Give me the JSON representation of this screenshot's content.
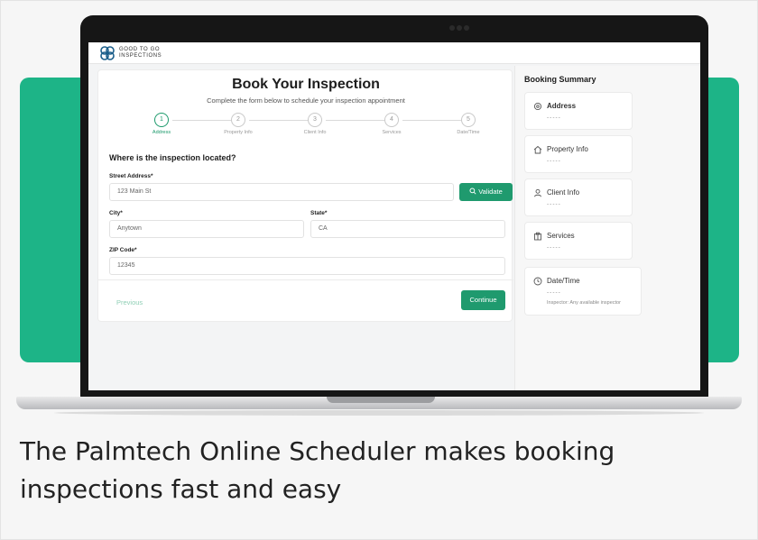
{
  "logo": {
    "line1": "GOOD TO GO",
    "line2": "INSPECTIONS"
  },
  "form": {
    "title": "Book Your Inspection",
    "subtitle": "Complete the form below to schedule your inspection appointment",
    "steps": [
      {
        "num": "1",
        "label": "Address"
      },
      {
        "num": "2",
        "label": "Property Info"
      },
      {
        "num": "3",
        "label": "Client Info"
      },
      {
        "num": "4",
        "label": "Services"
      },
      {
        "num": "5",
        "label": "Date/Time"
      }
    ],
    "question": "Where is the inspection located?",
    "street_label": "Street Address*",
    "street_value": "123 Main St",
    "validate_label": "Validate",
    "city_label": "City*",
    "city_value": "Anytown",
    "state_label": "State*",
    "state_value": "CA",
    "zip_label": "ZIP Code*",
    "zip_value": "12345",
    "previous_label": "Previous",
    "continue_label": "Continue"
  },
  "summary": {
    "title": "Booking Summary",
    "cards": [
      {
        "name": "Address",
        "value": "-----",
        "icon": "location-pin-icon"
      },
      {
        "name": "Property Info",
        "value": "-----",
        "icon": "home-icon"
      },
      {
        "name": "Client Info",
        "value": "-----",
        "icon": "user-icon"
      },
      {
        "name": "Services",
        "value": "-----",
        "icon": "clipboard-icon"
      },
      {
        "name": "Date/Time",
        "value": "-----",
        "note": "Inspector: Any available inspector",
        "icon": "clock-icon"
      }
    ]
  },
  "caption": "The Palmtech Online Scheduler makes booking inspections fast and easy",
  "colors": {
    "accent_green": "#1f9a6e",
    "banner_green": "#1db487"
  }
}
